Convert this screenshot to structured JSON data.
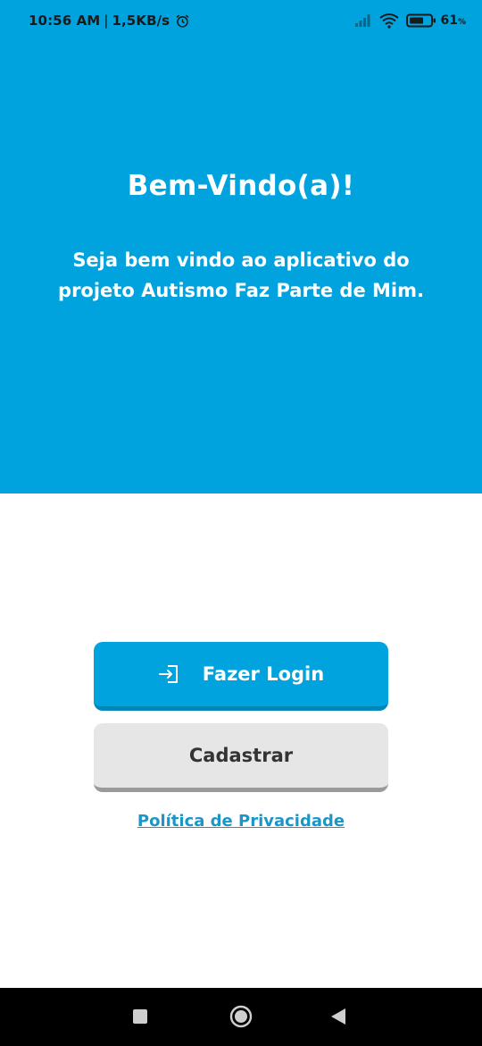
{
  "status_bar": {
    "time": "10:56 AM",
    "separator": "|",
    "speed": "1,5KB/s",
    "battery_percent": "61",
    "battery_unit": "%",
    "icons": [
      "alarm-icon",
      "signal-icon",
      "wifi-icon",
      "battery-icon"
    ]
  },
  "hero": {
    "title": "Bem-Vindo(a)!",
    "message": "Seja bem vindo ao aplicativo do projeto Autismo Faz Parte de Mim."
  },
  "actions": {
    "login_label": "Fazer Login",
    "login_icon": "login-icon",
    "register_label": "Cadastrar",
    "privacy_label": "Política de Privacidade"
  },
  "nav": {
    "icons": [
      "recents-icon",
      "home-icon",
      "back-icon"
    ]
  },
  "colors": {
    "primary": "#00a3de",
    "primary_dark": "#0086b8",
    "secondary": "#e6e6e6",
    "link": "#1a96c8",
    "nav_bar": "#000000"
  }
}
